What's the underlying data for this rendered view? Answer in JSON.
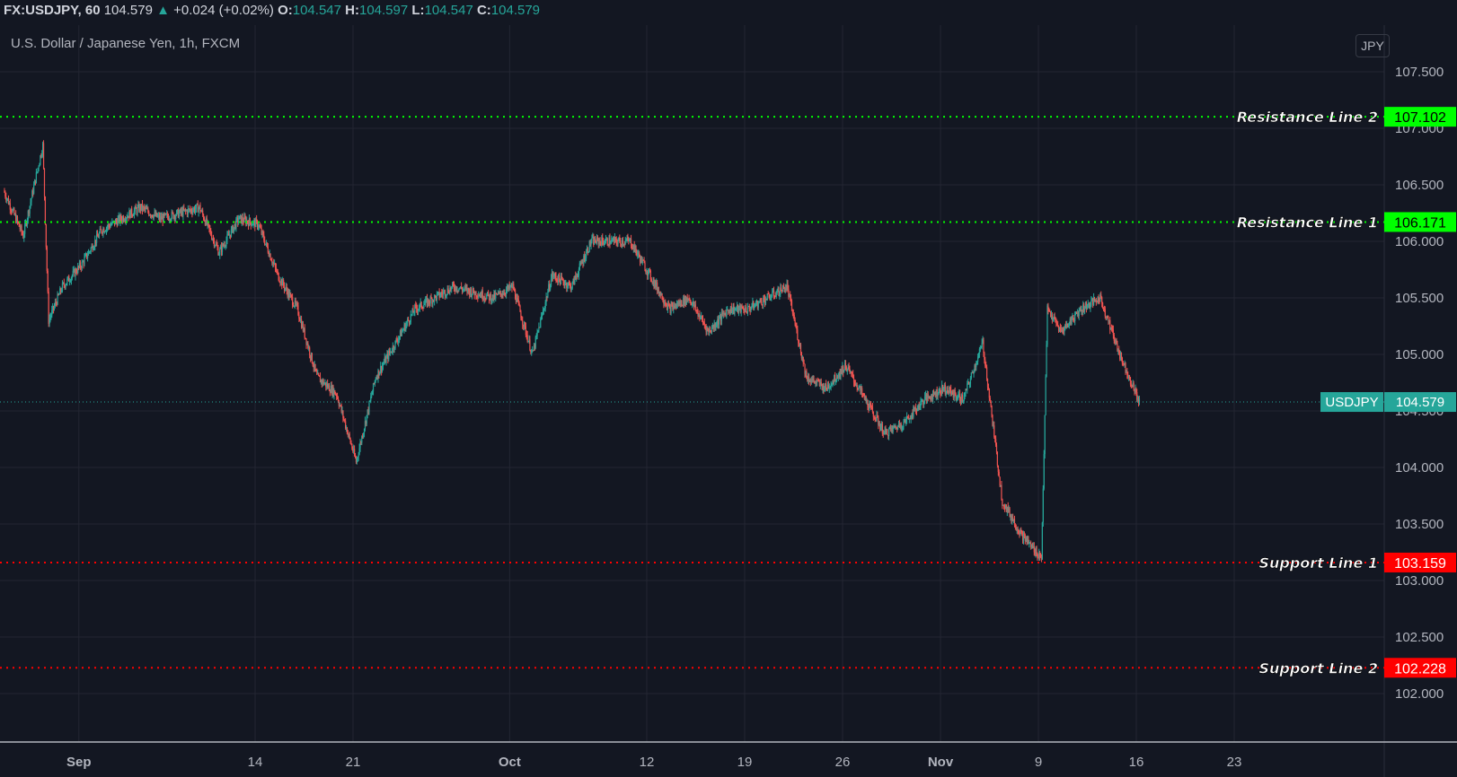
{
  "header": {
    "symbol": "FX:USDJPY, 60",
    "last": "104.579",
    "change": "+0.024 (+0.02%)",
    "o_label": "O:",
    "o": "104.547",
    "h_label": "H:",
    "h": "104.597",
    "l_label": "L:",
    "l": "104.547",
    "c_label": "C:",
    "c": "104.579",
    "up_icon": "triangle-up-icon"
  },
  "title": "U.S. Dollar / Japanese Yen, 1h, FXCM",
  "currency_button": "JPY",
  "colors": {
    "up": "#26a69a",
    "down": "#ef5350",
    "resistance": "#00ff00",
    "support": "#ff0000",
    "background": "#131722"
  },
  "chart_data": {
    "type": "candlestick",
    "title": "U.S. Dollar / Japanese Yen, 1h, FXCM",
    "ylim": [
      101.8,
      107.8
    ],
    "yticks": [
      "102.000",
      "102.500",
      "103.000",
      "103.500",
      "104.000",
      "104.500",
      "105.000",
      "105.500",
      "106.000",
      "106.500",
      "107.000",
      "107.500"
    ],
    "xticks": [
      {
        "label": "Sep",
        "date": "2020-09-01"
      },
      {
        "label": "14",
        "date": "2020-09-14"
      },
      {
        "label": "21",
        "date": "2020-09-21"
      },
      {
        "label": "Oct",
        "date": "2020-10-01"
      },
      {
        "label": "12",
        "date": "2020-10-12"
      },
      {
        "label": "19",
        "date": "2020-10-19"
      },
      {
        "label": "26",
        "date": "2020-10-26"
      },
      {
        "label": "Nov",
        "date": "2020-11-02"
      },
      {
        "label": "9",
        "date": "2020-11-09"
      },
      {
        "label": "16",
        "date": "2020-11-16"
      },
      {
        "label": "23",
        "date": "2020-11-23"
      }
    ],
    "price_path": [
      [
        "2020-08-26",
        106.45
      ],
      [
        "2020-08-27",
        106.05
      ],
      [
        "2020-08-28",
        106.85
      ],
      [
        "2020-08-28",
        105.3
      ],
      [
        "2020-08-31",
        105.6
      ],
      [
        "2020-09-01",
        105.8
      ],
      [
        "2020-09-02",
        106.1
      ],
      [
        "2020-09-04",
        106.3
      ],
      [
        "2020-09-07",
        106.2
      ],
      [
        "2020-09-09",
        106.3
      ],
      [
        "2020-09-10",
        105.9
      ],
      [
        "2020-09-11",
        106.2
      ],
      [
        "2020-09-14",
        106.15
      ],
      [
        "2020-09-15",
        105.7
      ],
      [
        "2020-09-16",
        105.4
      ],
      [
        "2020-09-17",
        104.8
      ],
      [
        "2020-09-18",
        104.65
      ],
      [
        "2020-09-21",
        104.05
      ],
      [
        "2020-09-22",
        104.8
      ],
      [
        "2020-09-23",
        105.1
      ],
      [
        "2020-09-24",
        105.4
      ],
      [
        "2020-09-25",
        105.5
      ],
      [
        "2020-09-28",
        105.6
      ],
      [
        "2020-09-30",
        105.5
      ],
      [
        "2020-10-01",
        105.6
      ],
      [
        "2020-10-02",
        105.0
      ],
      [
        "2020-10-05",
        105.7
      ],
      [
        "2020-10-06",
        105.6
      ],
      [
        "2020-10-07",
        106.0
      ],
      [
        "2020-10-09",
        106.0
      ],
      [
        "2020-10-12",
        105.7
      ],
      [
        "2020-10-13",
        105.4
      ],
      [
        "2020-10-14",
        105.5
      ],
      [
        "2020-10-15",
        105.2
      ],
      [
        "2020-10-16",
        105.4
      ],
      [
        "2020-10-19",
        105.4
      ],
      [
        "2020-10-21",
        105.6
      ],
      [
        "2020-10-22",
        104.8
      ],
      [
        "2020-10-23",
        104.7
      ],
      [
        "2020-10-26",
        104.9
      ],
      [
        "2020-10-27",
        104.6
      ],
      [
        "2020-10-28",
        104.3
      ],
      [
        "2020-10-29",
        104.4
      ],
      [
        "2020-10-30",
        104.6
      ],
      [
        "2020-11-02",
        104.7
      ],
      [
        "2020-11-03",
        104.6
      ],
      [
        "2020-11-04",
        105.1
      ],
      [
        "2020-11-05",
        103.7
      ],
      [
        "2020-11-06",
        103.4
      ],
      [
        "2020-11-09",
        103.2
      ],
      [
        "2020-11-09",
        105.4
      ],
      [
        "2020-11-10",
        105.2
      ],
      [
        "2020-11-11",
        105.4
      ],
      [
        "2020-11-12",
        105.5
      ],
      [
        "2020-11-13",
        105.0
      ],
      [
        "2020-11-16",
        104.58
      ]
    ],
    "current_price": {
      "label": "USDJPY",
      "value": "104.579"
    },
    "horizontal_lines": [
      {
        "name": "Resistance Line 2",
        "value": 107.102,
        "label": "107.102",
        "kind": "resistance"
      },
      {
        "name": "Resistance Line 1",
        "value": 106.171,
        "label": "106.171",
        "kind": "resistance"
      },
      {
        "name": "Support Line 1",
        "value": 103.159,
        "label": "103.159",
        "kind": "support"
      },
      {
        "name": "Support Line 2",
        "value": 102.228,
        "label": "102.228",
        "kind": "support"
      }
    ],
    "grid": true
  }
}
